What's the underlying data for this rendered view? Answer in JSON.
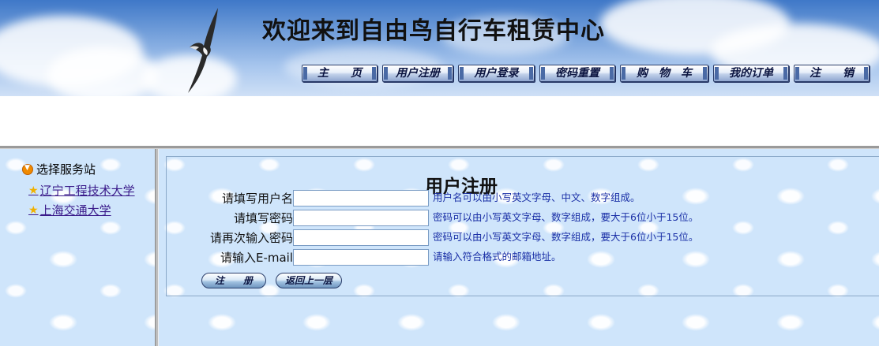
{
  "header": {
    "title": "欢迎来到自由鸟自行车租赁中心",
    "nav": [
      "主　　页",
      "用户注册",
      "用户登录",
      "密码重置",
      "购　物　车",
      "我的订单",
      "注　　销"
    ]
  },
  "sidebar": {
    "heading": "选择服务站",
    "links": [
      "辽宁工程技术大学",
      "上海交通大学"
    ]
  },
  "form": {
    "title": "用户注册",
    "fields": [
      {
        "label": "请填写用户名",
        "value": "",
        "hint": "用户名可以由小写英文字母、中文、数字组成。"
      },
      {
        "label": "请填写密码",
        "value": "",
        "hint": "密码可以由小写英文字母、数字组成，要大于6位小于15位。"
      },
      {
        "label": "请再次输入密码",
        "value": "",
        "hint": "密码可以由小写英文字母、数字组成，要大于6位小于15位。"
      },
      {
        "label": "请输入E-mail",
        "value": "",
        "hint": "请输入符合格式的邮箱地址。"
      }
    ],
    "submit_label": "注　　册",
    "back_label": "返回上一层"
  },
  "colors": {
    "hint_text": "#1a2fa6",
    "link_text": "#3a1a8a",
    "sky": "#cfe5fb"
  },
  "icons": {
    "sidebar_heading": "orange-down-arrow-icon",
    "link": "star-icon",
    "banner": "seagull-image"
  }
}
